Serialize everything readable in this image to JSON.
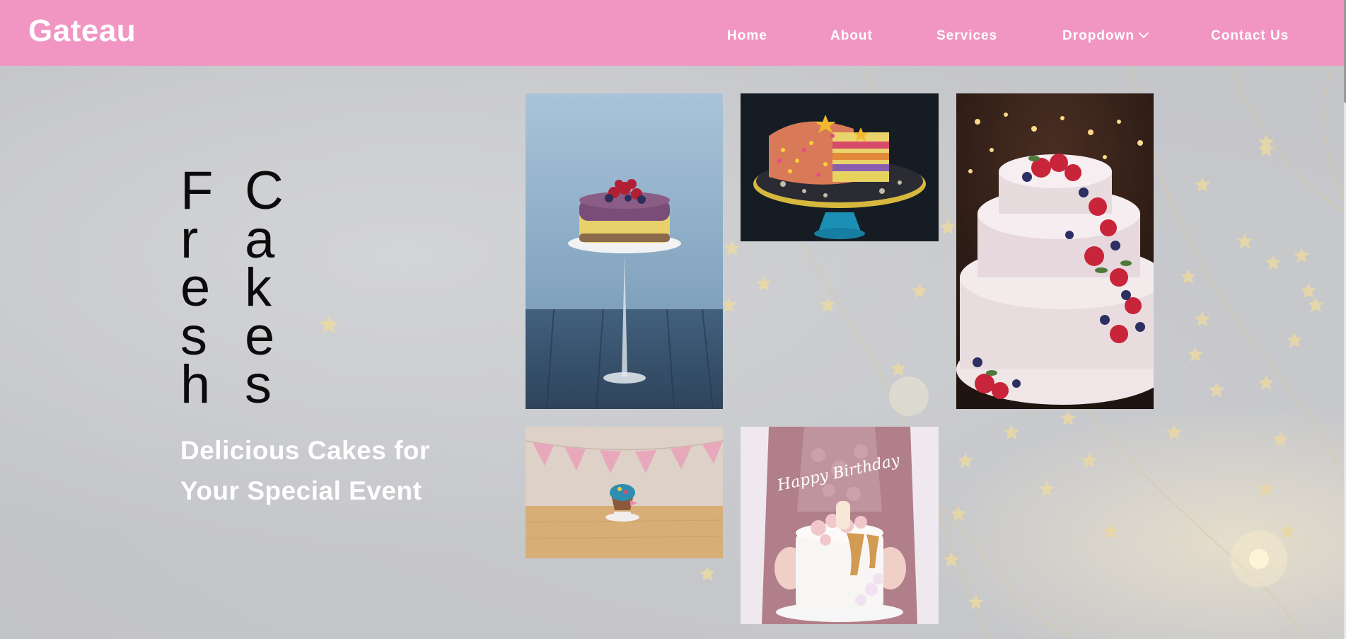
{
  "brand": {
    "logo_text": "Gateau"
  },
  "nav": {
    "items": [
      {
        "label": "Home"
      },
      {
        "label": "About"
      },
      {
        "label": "Services"
      },
      {
        "label": "Dropdown",
        "has_chevron": true
      },
      {
        "label": "Contact Us"
      }
    ]
  },
  "hero": {
    "word1": [
      "F",
      "r",
      "e",
      "s",
      "h"
    ],
    "word2": [
      "C",
      "a",
      "k",
      "e",
      "s"
    ],
    "subtitle_line1": "Delicious Cakes for",
    "subtitle_line2": "Your Special Event"
  },
  "gallery": {
    "images": [
      {
        "name": "cake-on-glass-stand"
      },
      {
        "name": "sprinkle-layer-cake"
      },
      {
        "name": "berry-wedding-cake"
      },
      {
        "name": "cupcake-with-bunting"
      },
      {
        "name": "happy-birthday-cake"
      }
    ],
    "birthday_topper": "Happy Birthday"
  },
  "colors": {
    "header": "#f196c2",
    "background": "#c7c9cc",
    "hero_text": "#0b0b0b",
    "subtitle_text": "#ffffff"
  }
}
